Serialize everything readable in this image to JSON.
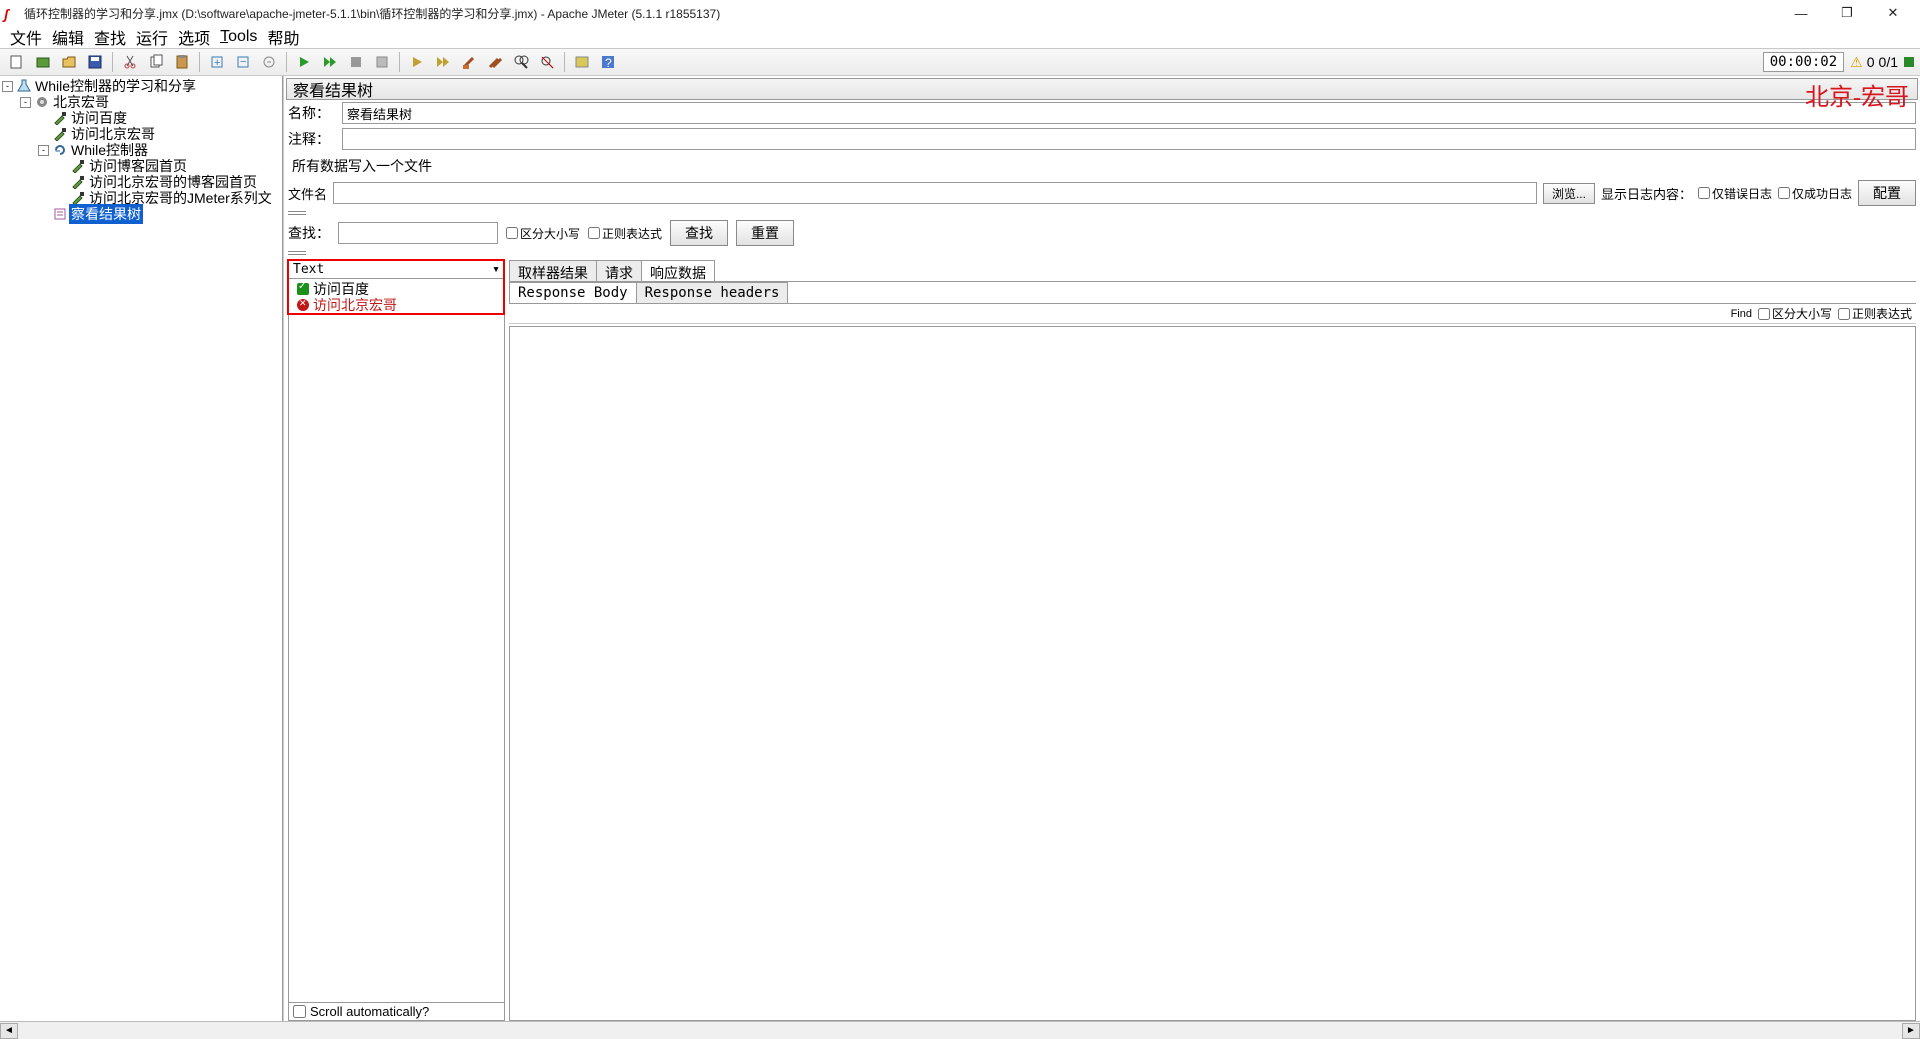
{
  "title": "循环控制器的学习和分享.jmx (D:\\software\\apache-jmeter-5.1.1\\bin\\循环控制器的学习和分享.jmx) - Apache JMeter (5.1.1 r1855137)",
  "menus": [
    "文件",
    "编辑",
    "查找",
    "运行",
    "选项",
    "Tools",
    "帮助"
  ],
  "toolbar_timer": "00:00:02",
  "toolbar_status": {
    "warn": 0,
    "threads": "0/1"
  },
  "tree": [
    {
      "indent": 0,
      "toggle": "-",
      "icon": "flask",
      "label": "While控制器的学习和分享"
    },
    {
      "indent": 1,
      "toggle": "-",
      "icon": "gear",
      "label": "北京宏哥"
    },
    {
      "indent": 2,
      "toggle": "",
      "icon": "pipette",
      "label": "访问百度"
    },
    {
      "indent": 2,
      "toggle": "",
      "icon": "pipette",
      "label": "访问北京宏哥"
    },
    {
      "indent": 2,
      "toggle": "-",
      "icon": "loop",
      "label": "While控制器"
    },
    {
      "indent": 3,
      "toggle": "",
      "icon": "pipette",
      "label": "访问博客园首页"
    },
    {
      "indent": 3,
      "toggle": "",
      "icon": "pipette",
      "label": "访问北京宏哥的博客园首页"
    },
    {
      "indent": 3,
      "toggle": "",
      "icon": "pipette",
      "label": "访问北京宏哥的JMeter系列文"
    },
    {
      "indent": 2,
      "toggle": "",
      "icon": "result",
      "label": "察看结果树",
      "selected": true
    }
  ],
  "panel": {
    "title": "察看结果树",
    "watermark": "北京-宏哥",
    "name_label": "名称：",
    "name_value": "察看结果树",
    "comments_label": "注释：",
    "comments_value": "",
    "file_group_title": "所有数据写入一个文件",
    "filename_label": "文件名",
    "filename_value": "",
    "browse_btn": "浏览...",
    "show_log_label": "显示日志内容：",
    "only_error_log": "仅错误日志",
    "only_success_log": "仅成功日志",
    "config_btn": "配置",
    "search_label": "查找：",
    "case_sensitive": "区分大小写",
    "regex": "正则表达式",
    "search_btn": "查找",
    "reset_btn": "重置",
    "dropdown_value": "Text",
    "results": [
      {
        "status": "ok",
        "label": "访问百度"
      },
      {
        "status": "err",
        "label": "访问北京宏哥"
      }
    ],
    "scroll_auto_label": "Scroll automatically?",
    "tabs": [
      "取样器结果",
      "请求",
      "响应数据"
    ],
    "active_tab": 2,
    "subtabs": [
      "Response Body",
      "Response headers"
    ],
    "active_subtab": 0,
    "find_label": "Find",
    "find_case": "区分大小写",
    "find_regex": "正则表达式"
  }
}
